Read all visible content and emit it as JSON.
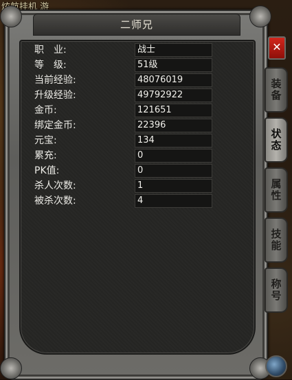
{
  "background": {
    "top_text": "炫航挂机 游"
  },
  "window": {
    "title": "二师兄",
    "close_label": "✕"
  },
  "stats": [
    {
      "label": "职　业:",
      "value": "战士"
    },
    {
      "label": "等　级:",
      "value": "51级"
    },
    {
      "label": "当前经验:",
      "value": "48076019"
    },
    {
      "label": "升级经验:",
      "value": "49792922"
    },
    {
      "label": "金币:",
      "value": "121651"
    },
    {
      "label": "绑定金币:",
      "value": "22396"
    },
    {
      "label": "元宝:",
      "value": "134"
    },
    {
      "label": "累充:",
      "value": "0"
    },
    {
      "label": "PK值:",
      "value": "0"
    },
    {
      "label": "杀人次数:",
      "value": "1"
    },
    {
      "label": "被杀次数:",
      "value": "4"
    }
  ],
  "tabs": [
    {
      "label": "装备",
      "active": false
    },
    {
      "label": "状态",
      "active": true
    },
    {
      "label": "属性",
      "active": false
    },
    {
      "label": "技能",
      "active": false
    },
    {
      "label": "称号",
      "active": false
    }
  ],
  "colors": {
    "close": "#d2261c",
    "panel": "#262624",
    "frame": "#6d6c68"
  }
}
